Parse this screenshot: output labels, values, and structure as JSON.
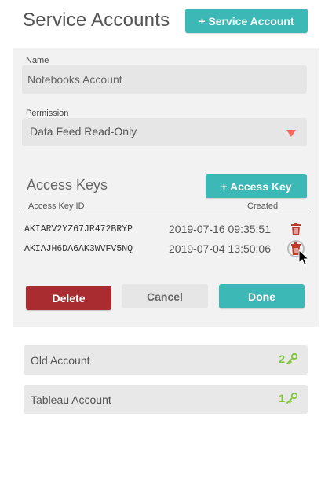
{
  "header": {
    "title": "Service Accounts",
    "add_service_account_label": "+ Service Account"
  },
  "form": {
    "name_label": "Name",
    "name_value": "Notebooks Account",
    "permission_label": "Permission",
    "permission_value": "Data Feed Read-Only"
  },
  "access_keys": {
    "title": "Access Keys",
    "add_key_label": "+ Access Key",
    "col_id": "Access Key ID",
    "col_created": "Created",
    "rows": [
      {
        "id": "AKIARV2YZ67JR472BRYP",
        "created": "2019-07-16 09:35:51"
      },
      {
        "id": "AKIAJH6DA6AK3WVFV5NQ",
        "created": "2019-07-04 13:50:06"
      }
    ]
  },
  "actions": {
    "delete_label": "Delete",
    "cancel_label": "Cancel",
    "done_label": "Done"
  },
  "accounts": [
    {
      "name": "Old Account",
      "key_count": "2"
    },
    {
      "name": "Tableau Account",
      "key_count": "1"
    }
  ],
  "colors": {
    "accent": "#3cb8b7",
    "danger": "#a82c30",
    "key_green": "#7fc639",
    "trash_red": "#c0392b",
    "caret": "#f26b5b"
  },
  "icons": {
    "trash": "trash-icon",
    "key": "key-icon",
    "caret": "chevron-down-icon",
    "cursor": "mouse-cursor-icon"
  }
}
